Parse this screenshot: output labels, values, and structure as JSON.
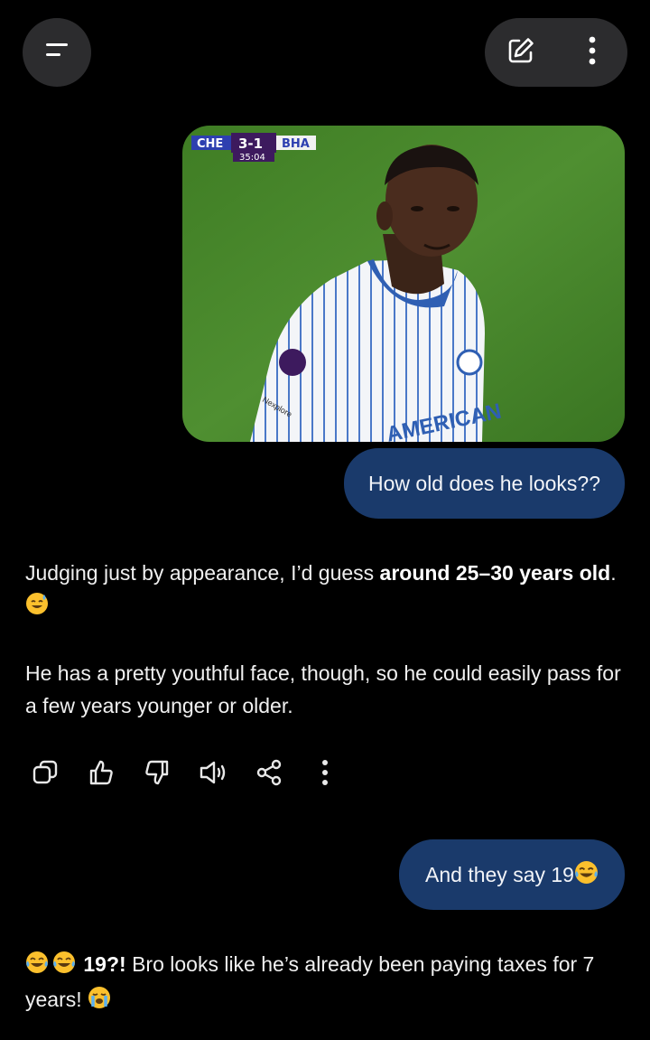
{
  "header": {
    "menu_icon": "menu-icon",
    "new_chat_icon": "edit-icon",
    "more_icon": "more-vertical-icon"
  },
  "messages": {
    "user_image": {
      "scoreboard": {
        "home": "CHE",
        "score": "3-1",
        "away": "BHA",
        "clock": "35:04"
      },
      "jersey_text": "AMERICAN",
      "sleeve_text": "Nexplore"
    },
    "user_1": "How old does he looks??",
    "assistant_1": {
      "p1_pre": "Judging just by appearance, I’d guess ",
      "p1_bold": "around 25–30 years old",
      "p1_post": ".",
      "p1_emoji": "sweat-smile-emoji",
      "p2": "He has a pretty youthful face, though, so he could easily pass for a few years younger or older."
    },
    "user_2": "And they say 19",
    "user_2_emoji": "tears-of-joy-emoji",
    "assistant_2": {
      "lead_emoji": "tears-of-joy-emoji",
      "bold": "19?!",
      "text": " Bro looks like he’s already been paying taxes for 7 years! ",
      "trail_emoji": "loudly-crying-emoji"
    }
  },
  "actions": {
    "icons": [
      "copy-icon",
      "thumbs-up-icon",
      "thumbs-down-icon",
      "speaker-icon",
      "share-icon",
      "more-vertical-icon"
    ]
  },
  "colors": {
    "background": "#000000",
    "control_bg": "#2c2c2e",
    "user_bubble": "#1a3a6b",
    "pitch": "#4a8a2c",
    "kit_stripe": "#3b6fc4"
  }
}
